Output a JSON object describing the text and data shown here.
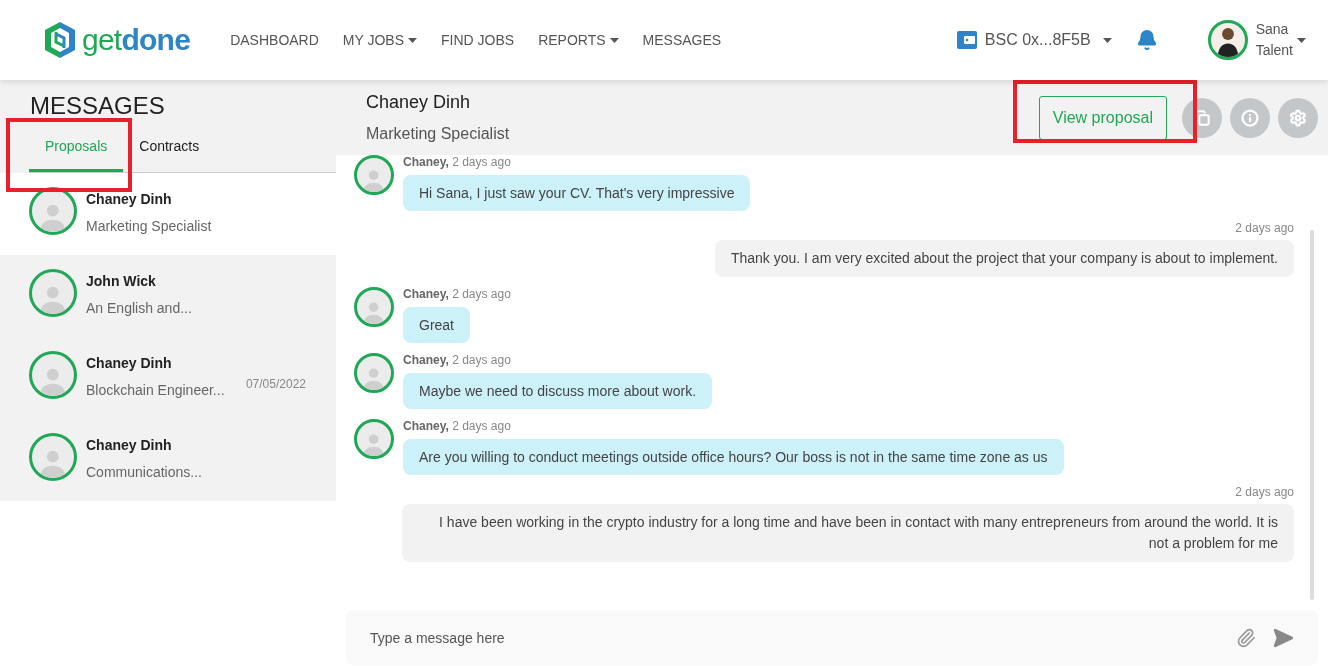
{
  "brand": {
    "part1": "get",
    "part2": "done"
  },
  "nav": [
    {
      "label": "DASHBOARD",
      "dropdown": false
    },
    {
      "label": "MY JOBS",
      "dropdown": true
    },
    {
      "label": "FIND JOBS",
      "dropdown": false
    },
    {
      "label": "REPORTS",
      "dropdown": true
    },
    {
      "label": "MESSAGES",
      "dropdown": false
    }
  ],
  "wallet": {
    "label": "BSC 0x...8F5B"
  },
  "user": {
    "first": "Sana",
    "second": "Talent"
  },
  "sidebar": {
    "title": "MESSAGES",
    "tabs": [
      {
        "label": "Proposals",
        "selected": true
      },
      {
        "label": "Contracts",
        "selected": false
      }
    ],
    "conversations": [
      {
        "name": "Chaney Dinh",
        "subtitle": "Marketing Specialist",
        "selected": true
      },
      {
        "name": "John Wick",
        "subtitle": "An English and...",
        "selected": false
      },
      {
        "name": "Chaney Dinh",
        "subtitle": "Blockchain Engineer...",
        "date": "07/05/2022",
        "selected": false
      },
      {
        "name": "Chaney Dinh",
        "subtitle": "Communications...",
        "selected": false
      }
    ]
  },
  "chat": {
    "name": "Chaney Dinh",
    "role": "Marketing Specialist",
    "action": "View proposal",
    "messages": [
      {
        "kind": "incoming",
        "author": "Chaney,",
        "time": "2 days ago",
        "text": "Hi Sana, I just saw your CV. That's very impressive"
      },
      {
        "kind": "outgoing",
        "time": "2 days ago",
        "text": "Thank you. I am very excited about the project that your company is about to implement."
      },
      {
        "kind": "incoming",
        "author": "Chaney,",
        "time": "2 days ago",
        "text": "Great"
      },
      {
        "kind": "incoming",
        "author": "Chaney,",
        "time": "2 days ago",
        "text": "Maybe we need to discuss more about work."
      },
      {
        "kind": "incoming",
        "author": "Chaney,",
        "time": "2 days ago",
        "text": "Are you willing to conduct meetings outside office hours? Our boss is not in the same time zone as us"
      },
      {
        "kind": "outgoing",
        "time": "2 days ago",
        "text": "I have been working in the crypto industry for a long time and have been in contact with many entrepreneurs from around the world. It is not a problem for me"
      }
    ],
    "composer": {
      "placeholder": "Type a message here"
    }
  }
}
